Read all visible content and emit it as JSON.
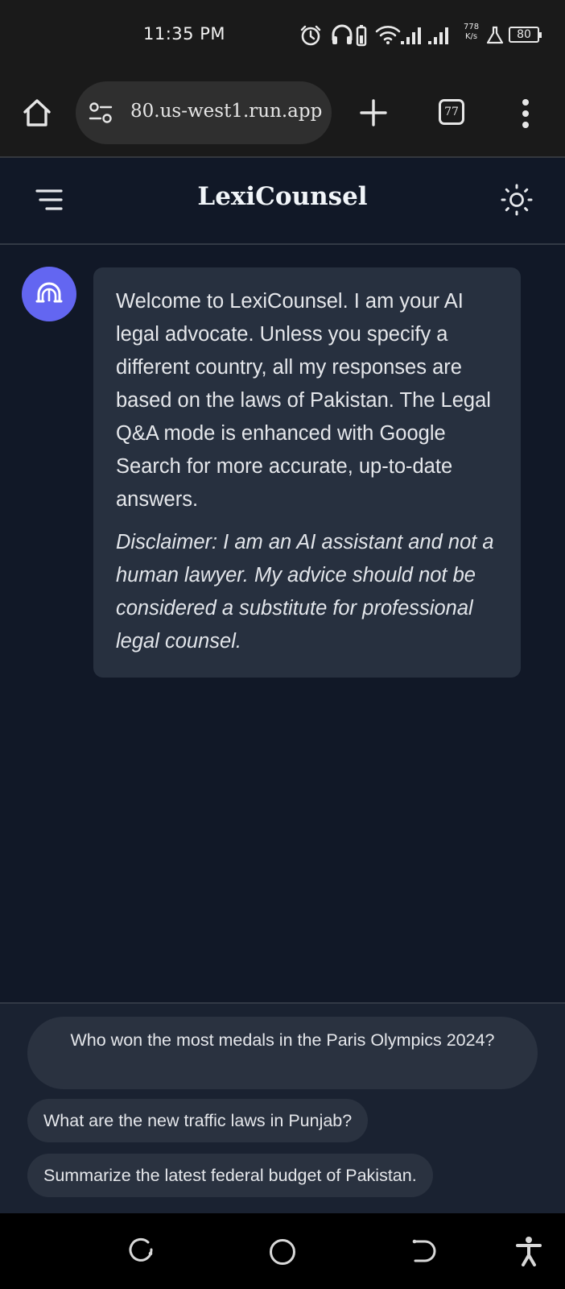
{
  "status_bar": {
    "time": "11:35 PM",
    "net_speed_value": "778",
    "net_speed_unit": "K/s",
    "battery": "80"
  },
  "browser": {
    "url": "80.us-west1.run.app",
    "tab_count": "77"
  },
  "app": {
    "title": "LexiCounsel"
  },
  "chat": {
    "messages": [
      {
        "role": "assistant",
        "text": "Welcome to LexiCounsel. I am your AI legal advocate. Unless you specify a different country, all my responses are based on the laws of Pakistan. The Legal Q&A mode is enhanced with Google Search for more accurate, up-to-date answers.",
        "disclaimer": "Disclaimer: I am an AI assistant and not a human lawyer. My advice should not be considered a substitute for professional legal counsel."
      }
    ]
  },
  "suggestions": [
    "Who won the most medals in the Paris Olympics 2024?",
    "What are the new traffic laws in Punjab?",
    "Summarize the latest federal budget of Pakistan."
  ],
  "colors": {
    "accent": "#6366f1",
    "background": "#111827",
    "bubble": "#27303f"
  },
  "icons": {
    "home": "home-icon",
    "site_settings": "site-settings-icon",
    "new_tab": "plus-icon",
    "menu": "more-vertical-icon",
    "sidebar": "menu-icon",
    "theme": "sun-icon",
    "avatar": "legal-advocate-icon"
  }
}
